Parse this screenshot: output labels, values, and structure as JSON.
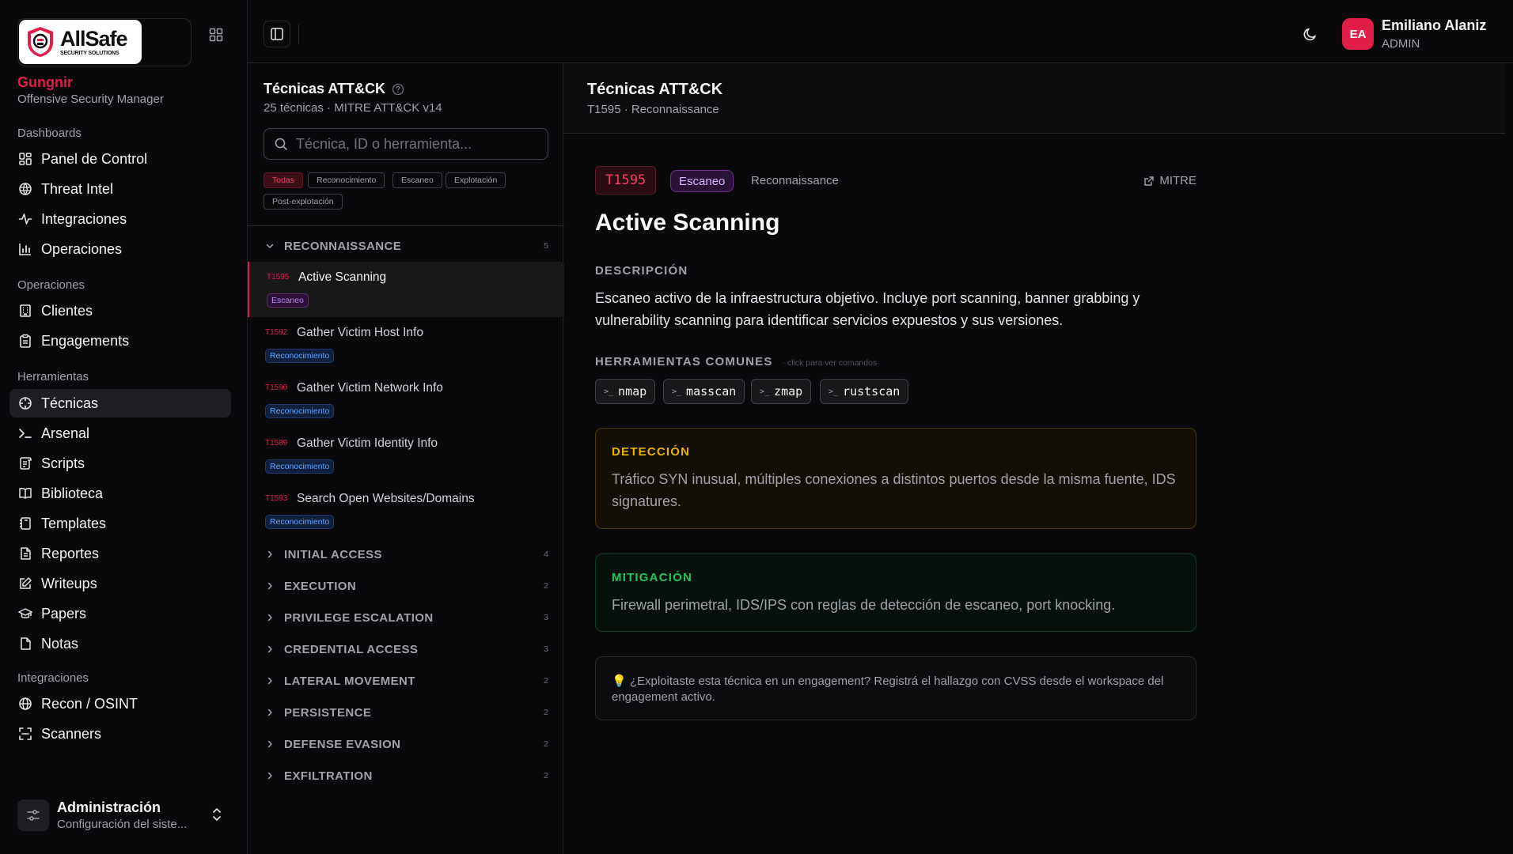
{
  "brand": {
    "logo_text": "AllSafe",
    "logo_subtext": "SECURITY SOLUTIONS",
    "org_name": "Gungnir",
    "org_role": "Offensive Security Manager"
  },
  "sidebar": {
    "sections": [
      {
        "label": "Dashboards",
        "items": [
          {
            "label": "Panel de Control",
            "icon": "dashboard-icon"
          },
          {
            "label": "Threat Intel",
            "icon": "threat-intel-icon"
          },
          {
            "label": "Integraciones",
            "icon": "activity-icon"
          },
          {
            "label": "Operaciones",
            "icon": "bar-chart-icon"
          }
        ]
      },
      {
        "label": "Operaciones",
        "items": [
          {
            "label": "Clientes",
            "icon": "building-icon"
          },
          {
            "label": "Engagements",
            "icon": "clipboard-icon"
          }
        ]
      },
      {
        "label": "Herramientas",
        "items": [
          {
            "label": "Técnicas",
            "icon": "crosshair-icon",
            "active": true
          },
          {
            "label": "Arsenal",
            "icon": "terminal-icon"
          },
          {
            "label": "Scripts",
            "icon": "scroll-icon"
          },
          {
            "label": "Biblioteca",
            "icon": "book-open-icon"
          },
          {
            "label": "Templates",
            "icon": "notebook-icon"
          },
          {
            "label": "Reportes",
            "icon": "file-text-icon"
          },
          {
            "label": "Writeups",
            "icon": "edit-icon"
          },
          {
            "label": "Papers",
            "icon": "graduation-cap-icon"
          },
          {
            "label": "Notas",
            "icon": "note-icon"
          }
        ]
      },
      {
        "label": "Integraciones",
        "items": [
          {
            "label": "Recon / OSINT",
            "icon": "globe-icon"
          },
          {
            "label": "Scanners",
            "icon": "scan-icon"
          }
        ]
      }
    ],
    "admin": {
      "title": "Administración",
      "subtitle": "Configuración del siste..."
    }
  },
  "topbar": {
    "user": {
      "initials": "EA",
      "name": "Emiliano Alaniz",
      "role": "ADMIN"
    }
  },
  "techniques": {
    "title": "Técnicas ATT&CK",
    "subtitle": "25 técnicas · MITRE ATT&CK v14",
    "search_placeholder": "Técnica, ID o herramienta...",
    "filters": [
      {
        "label": "Todas",
        "active": true
      },
      {
        "label": "Reconocimiento"
      },
      {
        "label": "Escaneo"
      },
      {
        "label": "Explotación"
      },
      {
        "label": "Post-explotación"
      }
    ],
    "groups": [
      {
        "name": "RECONNAISSANCE",
        "count": "5",
        "expanded": true,
        "items": [
          {
            "id": "T1595",
            "name": "Active Scanning",
            "badge": "Escaneo",
            "active": true
          },
          {
            "id": "T1592",
            "name": "Gather Victim Host Info",
            "badge": "Reconocimiento"
          },
          {
            "id": "T1590",
            "name": "Gather Victim Network Info",
            "badge": "Reconocimiento"
          },
          {
            "id": "T1589",
            "name": "Gather Victim Identity Info",
            "badge": "Reconocimiento"
          },
          {
            "id": "T1593",
            "name": "Search Open Websites/Domains",
            "badge": "Reconocimiento"
          }
        ]
      },
      {
        "name": "INITIAL ACCESS",
        "count": "4"
      },
      {
        "name": "EXECUTION",
        "count": "2"
      },
      {
        "name": "PRIVILEGE ESCALATION",
        "count": "3"
      },
      {
        "name": "CREDENTIAL ACCESS",
        "count": "3"
      },
      {
        "name": "LATERAL MOVEMENT",
        "count": "2"
      },
      {
        "name": "PERSISTENCE",
        "count": "2"
      },
      {
        "name": "DEFENSE EVASION",
        "count": "2"
      },
      {
        "name": "EXFILTRATION",
        "count": "2"
      }
    ]
  },
  "detail_header": {
    "title": "Técnicas ATT&CK",
    "subtitle": "T1595 · Reconnaissance"
  },
  "detail": {
    "id": "T1595",
    "tactic_badge": "Escaneo",
    "phase": "Reconnaissance",
    "mitre_link": "MITRE",
    "title": "Active Scanning",
    "description_label": "DESCRIPCIÓN",
    "description": "Escaneo activo de la infraestructura objetivo. Incluye port scanning, banner grabbing y vulnerability scanning para identificar servicios expuestos y sus versiones.",
    "tools_label": "HERRAMIENTAS COMUNES",
    "tools_hint": "· click para ver comandos",
    "tools": [
      "nmap",
      "masscan",
      "zmap",
      "rustscan"
    ],
    "detection_label": "DETECCIÓN",
    "detection": "Tráfico SYN inusual, múltiples conexiones a distintos puertos desde la misma fuente, IDS signatures.",
    "mitigation_label": "MITIGACIÓN",
    "mitigation": "Firewall perimetral, IDS/IPS con reglas de detección de escaneo, port knocking.",
    "tip": "💡 ¿Exploitaste esta técnica en un engagement? Registrá el hallazgo con CVSS desde el workspace del engagement activo."
  },
  "colors": {
    "accent": "#e11d48",
    "background": "#09090b",
    "detection": "#eab308",
    "mitigation": "#22c55e",
    "scan_badge": "#c084fc",
    "recon_badge": "#60a5fa"
  }
}
